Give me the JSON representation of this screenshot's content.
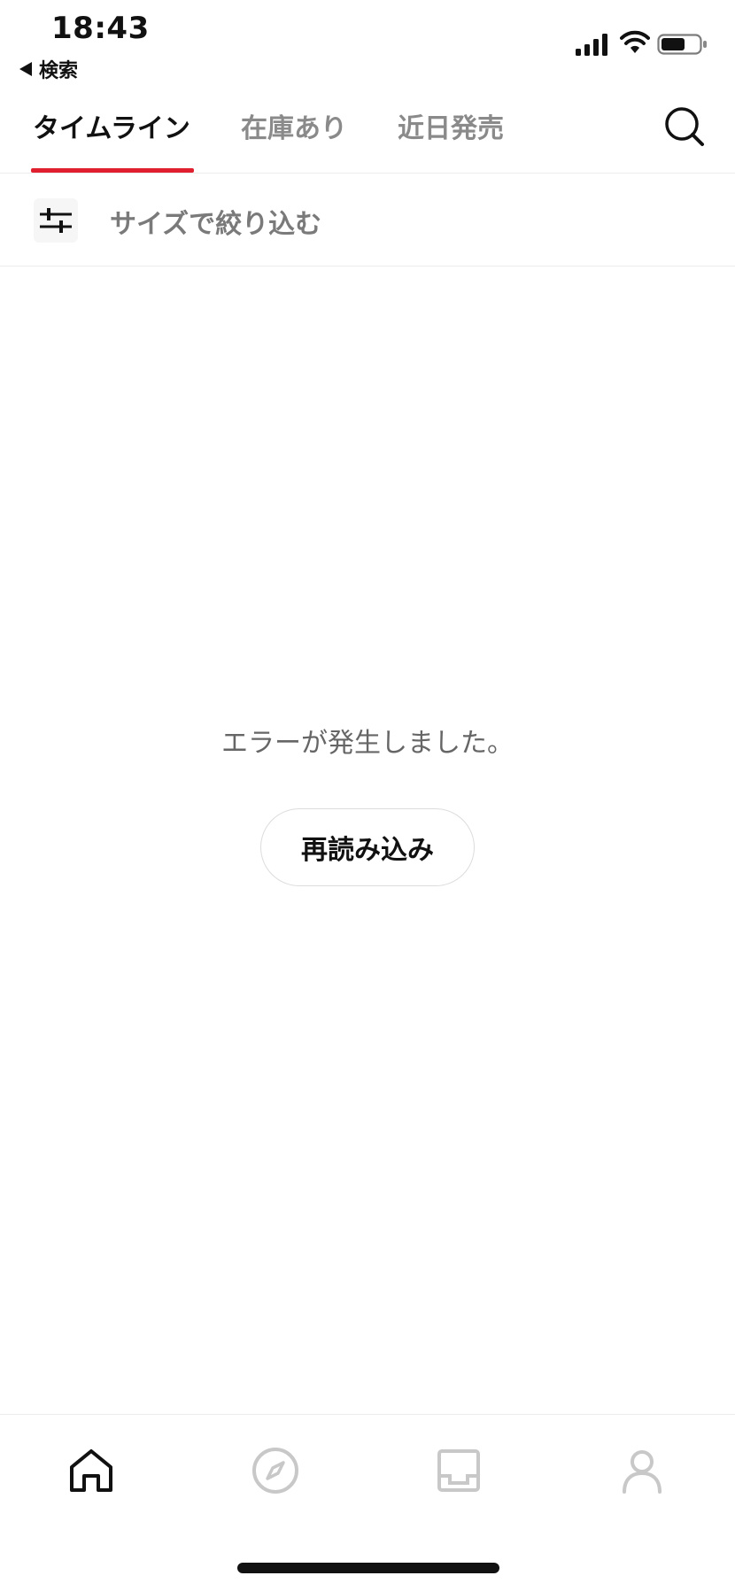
{
  "status_bar": {
    "time": "18:43",
    "back_label": "検索"
  },
  "tabs": [
    {
      "label": "タイムライン",
      "active": true
    },
    {
      "label": "在庫あり",
      "active": false
    },
    {
      "label": "近日発売",
      "active": false
    }
  ],
  "filter": {
    "label": "サイズで絞り込む"
  },
  "error": {
    "message": "エラーが発生しました。",
    "reload_label": "再読み込み"
  },
  "bottom_nav": [
    {
      "icon": "home-icon",
      "active": true
    },
    {
      "icon": "compass-icon",
      "active": false
    },
    {
      "icon": "inbox-icon",
      "active": false
    },
    {
      "icon": "profile-icon",
      "active": false
    }
  ],
  "colors": {
    "accent": "#e0202e",
    "inactive_icon": "#c8c8c8",
    "active_icon": "#111111"
  }
}
